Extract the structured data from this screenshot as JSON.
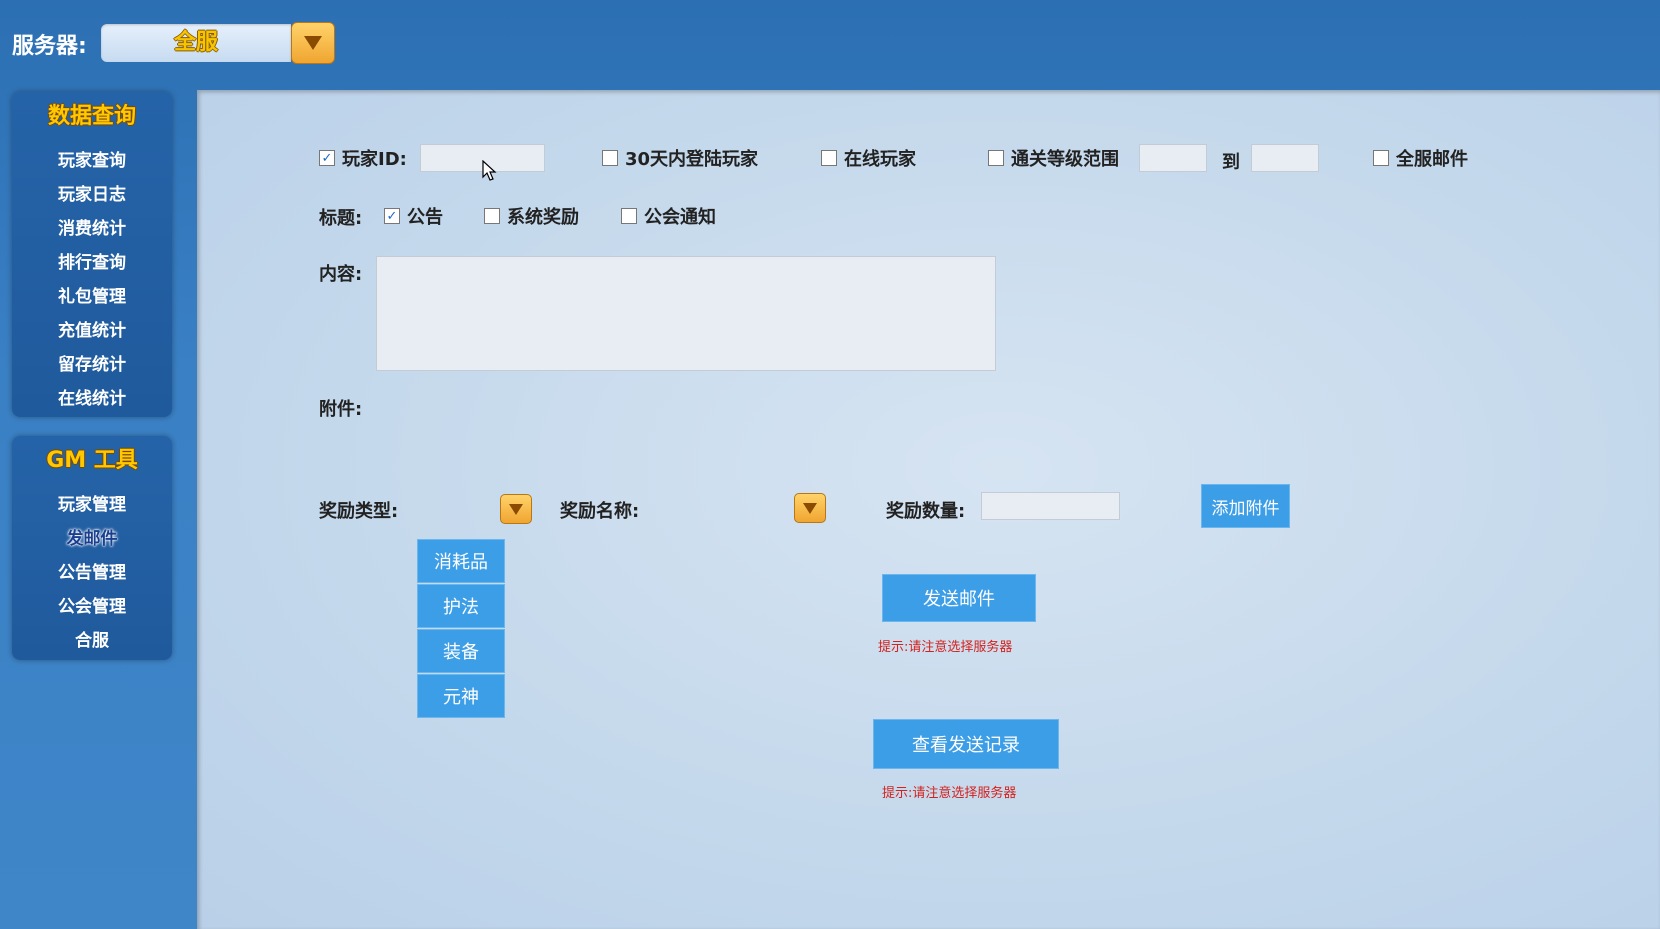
{
  "server": {
    "label": "服务器:",
    "value": "全服"
  },
  "sidebar": {
    "data_query": {
      "title": "数据查询",
      "items": [
        "玩家查询",
        "玩家日志",
        "消费统计",
        "排行查询",
        "礼包管理",
        "充值统计",
        "留存统计",
        "在线统计"
      ]
    },
    "gm_tools": {
      "title": "GM 工具",
      "items": [
        "玩家管理",
        "发邮件",
        "公告管理",
        "公会管理",
        "合服"
      ],
      "active": "发邮件"
    }
  },
  "filters": {
    "player_id": {
      "label": "玩家ID:",
      "checked": true,
      "value": ""
    },
    "login_30d": {
      "label": "30天内登陆玩家",
      "checked": false
    },
    "online": {
      "label": "在线玩家",
      "checked": false
    },
    "level_range": {
      "label": "通关等级范围",
      "checked": false,
      "from": "",
      "to_label": "到",
      "to": ""
    },
    "all_server_mail": {
      "label": "全服邮件",
      "checked": false
    }
  },
  "title_row": {
    "label": "标题:",
    "options": [
      {
        "label": "公告",
        "checked": true
      },
      {
        "label": "系统奖励",
        "checked": false
      },
      {
        "label": "公会通知",
        "checked": false
      }
    ]
  },
  "content": {
    "label": "内容:",
    "value": ""
  },
  "attachment": {
    "label": "附件:",
    "reward_type_label": "奖励类型:",
    "reward_name_label": "奖励名称:",
    "reward_qty_label": "奖励数量:",
    "reward_qty_value": "",
    "add_button": "添加附件",
    "type_options": [
      "消耗品",
      "护法",
      "装备",
      "元神"
    ]
  },
  "actions": {
    "send_mail": "发送邮件",
    "send_hint": "提示:请注意选择服务器",
    "view_records": "查看发送记录",
    "records_hint": "提示:请注意选择服务器"
  },
  "colors": {
    "accent": "#3d9ee8",
    "title_gold": "#ffc800",
    "hint_red": "#d4211d"
  }
}
